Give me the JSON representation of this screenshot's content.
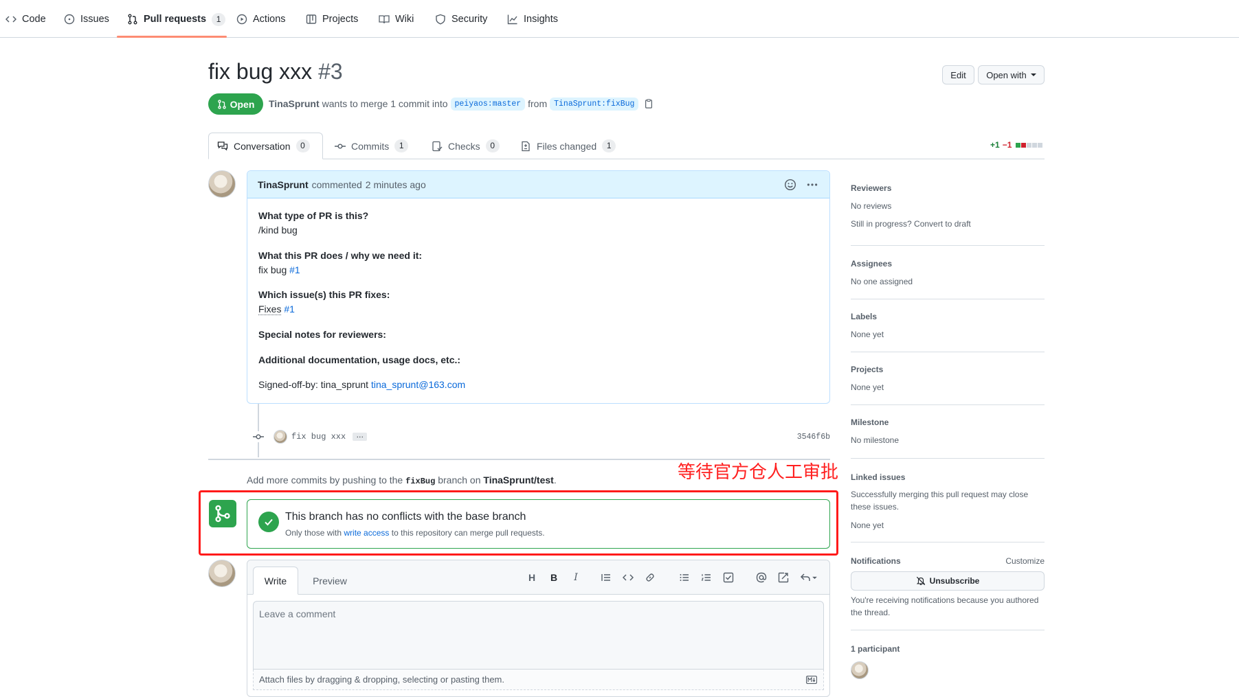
{
  "nav": {
    "items": [
      {
        "label": "Code",
        "icon": "code-icon"
      },
      {
        "label": "Issues",
        "icon": "issue-icon"
      },
      {
        "label": "Pull requests",
        "icon": "pull-request-icon",
        "count": "1"
      },
      {
        "label": "Actions",
        "icon": "play-icon"
      },
      {
        "label": "Projects",
        "icon": "table-icon"
      },
      {
        "label": "Wiki",
        "icon": "book-icon"
      },
      {
        "label": "Security",
        "icon": "shield-icon"
      },
      {
        "label": "Insights",
        "icon": "graph-icon"
      }
    ]
  },
  "pr": {
    "title": "fix bug xxx",
    "number": "#3",
    "state": "Open",
    "author": "TinaSprunt",
    "merge_text": "wants to merge 1 commit into",
    "base_branch": "peiyaos:master",
    "from_text": "from",
    "head_branch": "TinaSprunt:fixBug",
    "edit_label": "Edit",
    "open_with_label": "Open with"
  },
  "tabs": [
    {
      "label": "Conversation",
      "count": "0",
      "icon": "comment-discussion-icon"
    },
    {
      "label": "Commits",
      "count": "1",
      "icon": "commit-icon"
    },
    {
      "label": "Checks",
      "count": "0",
      "icon": "checklist-icon"
    },
    {
      "label": "Files changed",
      "count": "1",
      "icon": "file-diff-icon"
    }
  ],
  "diffstat": {
    "additions": "+1",
    "deletions": "−1"
  },
  "comment": {
    "author": "TinaSprunt",
    "action": "commented",
    "time": "2 minutes ago",
    "q1": "What type of PR is this?",
    "a1": "/kind bug",
    "q2": "What this PR does / why we need it:",
    "a2_text": "fix bug",
    "a2_link": "#1",
    "q3": "Which issue(s) this PR fixes:",
    "a3_text": "Fixes",
    "a3_link": "#1",
    "q4": "Special notes for reviewers:",
    "q5": "Additional documentation, usage docs, etc.:",
    "signoff_text": "Signed-off-by: tina_sprunt",
    "signoff_email": "tina_sprunt@163.com"
  },
  "commit": {
    "message": "fix bug xxx",
    "ellipsis": "…",
    "sha": "3546f6b"
  },
  "hint": {
    "pre": "Add more commits by pushing to the",
    "branch": "fixBug",
    "mid": "branch on",
    "repo": "TinaSprunt/test",
    "end": "."
  },
  "annotation": "等待官方仓人工审批",
  "merge": {
    "title": "This branch has no conflicts with the base branch",
    "sub_pre": "Only those with",
    "sub_link": "write access",
    "sub_post": "to this repository can merge pull requests."
  },
  "compose": {
    "write_tab": "Write",
    "preview_tab": "Preview",
    "placeholder": "Leave a comment",
    "attach": "Attach files by dragging & dropping, selecting or pasting them."
  },
  "sidebar": {
    "reviewers_h": "Reviewers",
    "reviewers_v": "No reviews",
    "reviewers_extra": "Still in progress? Convert to draft",
    "assignees_h": "Assignees",
    "assignees_v": "No one assigned",
    "labels_h": "Labels",
    "labels_v": "None yet",
    "projects_h": "Projects",
    "projects_v": "None yet",
    "milestone_h": "Milestone",
    "milestone_v": "No milestone",
    "linked_h": "Linked issues",
    "linked_d1": "Successfully merging this pull request may close",
    "linked_d2": "these issues.",
    "linked_v": "None yet",
    "notif_h": "Notifications",
    "notif_customize": "Customize",
    "unsubscribe": "Unsubscribe",
    "notif_d1": "You're receiving notifications because you authored",
    "notif_d2": "the thread.",
    "participants_h": "1 participant"
  },
  "colors": {
    "open_green": "#2da44e",
    "link_blue": "#0969da",
    "annotation_red": "#ff1a1a",
    "nav_underline": "#fd8c73"
  }
}
